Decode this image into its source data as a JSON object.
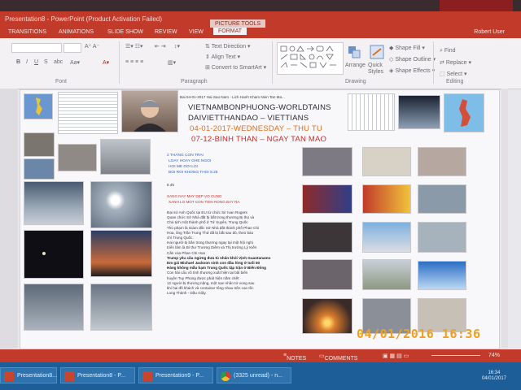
{
  "window": {
    "title": "Presentation8 - PowerPoint (Product Activation Failed)",
    "context_tab": "PICTURE TOOLS",
    "user": "Robert User"
  },
  "ribbon_tabs": [
    {
      "label": "TRANSITIONS"
    },
    {
      "label": "ANIMATIONS"
    },
    {
      "label": "SLIDE SHOW"
    },
    {
      "label": "REVIEW"
    },
    {
      "label": "VIEW"
    },
    {
      "label": "FORMAT",
      "active": true
    }
  ],
  "ribbon": {
    "groups": {
      "font": "Font",
      "paragraph": "Paragraph",
      "drawing": "Drawing",
      "editing": "Editing"
    },
    "paragraph_controls": {
      "text_direction": "Text Direction",
      "align_text": "Align Text",
      "convert_smartart": "Convert to SmartArt"
    },
    "drawing_controls": {
      "arrange": "Arrange",
      "quick_styles": "Quick Styles",
      "shape_fill": "Shape Fill",
      "shape_outline": "Shape Outline",
      "shape_effects": "Shape Effects"
    },
    "editing_controls": {
      "find": "Find",
      "replace": "Replace",
      "select": "Select"
    }
  },
  "slide": {
    "header_lines": [
      "VIETNAMBONPHUONG-WORLDTAINS",
      "DAIVIETTHANDAO – VIETTIANS",
      "04-01-2017-WEDNESDAY – THU TU",
      "07-12-BINH THAN – NGAY TAN MAO"
    ],
    "top_caption": "Bai 04-01-2017 Hai Sao Nam - Lich Hanh Kham Nien Tan Ma...",
    "blue_lines": [
      "2 THANG CON TRAI",
      "LOAY HOAY GHE NGOI",
      "HOI ME DOI LOI",
      "BOI ROI KHONG THOI 8.25"
    ],
    "time": "8.45",
    "red_lines": [
      "SANG NAY MAY DEP VO CUNG",
      "XANH LO MOT CON TIEN RONG BAY RA"
    ],
    "body_html": "Đại sứ Anh Quốc tại EU từ chức Sir Ivan Rogers<br>Quan chức Sở Nhà đất bị bắt trong thương Bị thụ và<br>Chủ tịch một thành phố ở Tứ Xuyên, Trung Quốc<br>Thủ phạm là Giám đốc Sở Nhà đất thành phố Phan Chi<br>Hoa, ông Trần Trung Thứ đã bị bắt sau đó, theo báo<br>chí Trung Quốc.<br>Hai người bị bắn trong thương ngay tại một hội nghị<br>triển lãm là Bí thư Trương Diêm và Thị trưởng Lý Kiến<br>Cần của Phan Chi Hoa<br><b>Trump yêu cầu ngừng đưa tù nhân khỏi Vịnh Guantanamo</b><br><b>Em gái Michael Jackson sinh con đầu lòng ở tuổi 50</b><br><b>Hàng không mẫu hạm Trung Quốc tập trận ở Biển Đông</b><br>Con hải cẩu vô tình thương xuất hiện tại bãi biển<br>huyện Tuy Phong được phát hiện nằm chết<br>12 người bị thương nặng, một nạn nhân tử vong sau<br>khi hai đồ khách và container tông nhau trên cao tốc<br>Long Thành - Dầu Giây."
  },
  "statusbar": {
    "notes": "NOTES",
    "comments": "COMMENTS",
    "zoom": "74%"
  },
  "taskbar": {
    "items": [
      {
        "label": "Presentation8..."
      },
      {
        "label": "Presentation8 - P..."
      },
      {
        "label": "Presentation9 - P..."
      },
      {
        "label": "(3325 unread) - n..."
      }
    ],
    "time": "16:34",
    "date": "04/01/2017"
  },
  "camera_stamp": "04/01/2016  16:36",
  "colors": {
    "accent": "#c23a2a",
    "taskbar": "#1d5e99",
    "header_orange": "#e0701d",
    "header_red": "#cc2a2a",
    "blue_text": "#2f5fc4",
    "stamp": "#f0a021"
  }
}
